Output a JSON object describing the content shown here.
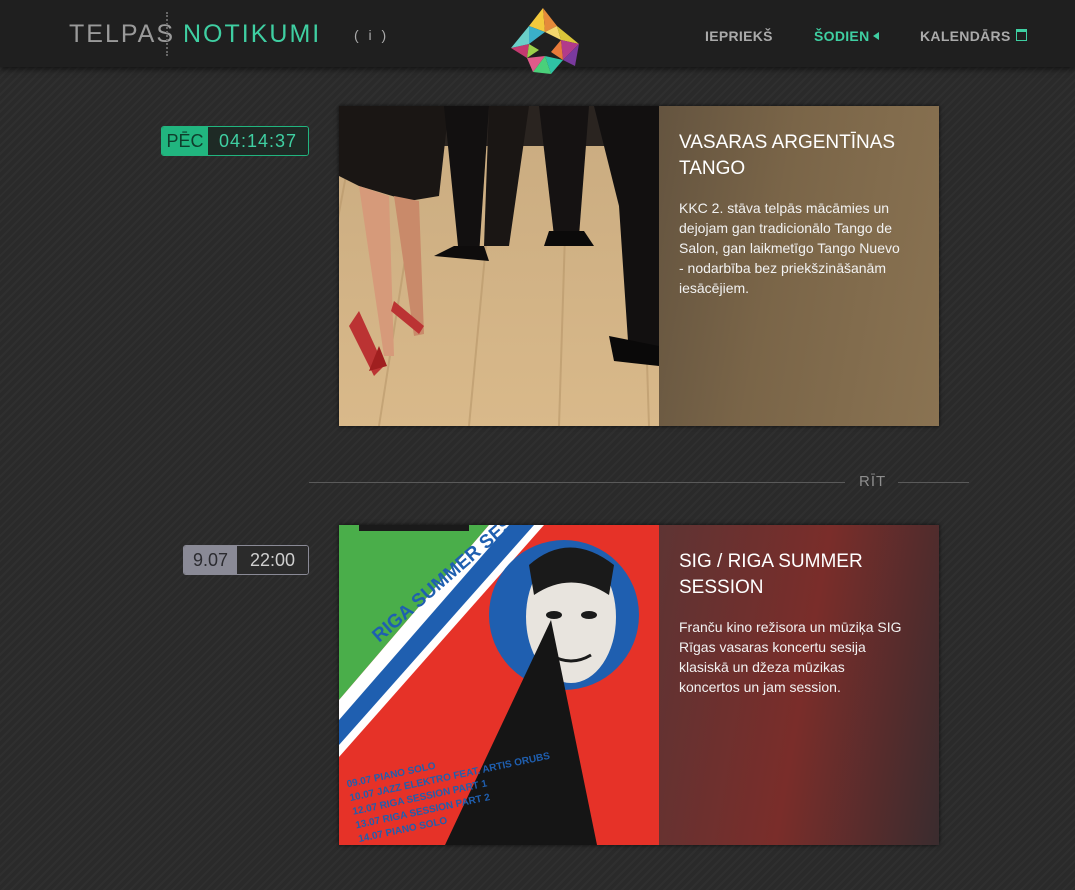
{
  "header": {
    "brand_left": "TELPAS",
    "brand_right": "NOTIKUMI",
    "info_label": "( i )",
    "nav": {
      "prev": "IEPRIEKŠ",
      "today": "ŠODIEN",
      "calendar": "KALENDĀRS"
    }
  },
  "colors": {
    "accent": "#3fcfa2",
    "badge_now": "#21b57f",
    "badge_future": "#8a8a96",
    "background": "#2a2a2a"
  },
  "events": [
    {
      "badge_left": "PĒC",
      "badge_right": "04:14:37",
      "title": "VASARAS ARGENTĪNAS TANGO",
      "description": "KKC 2. stāva telpās mācāmies un dejojam gan tradicionālo Tango de Salon, gan laikmetīgo Tango Nuevo - nodarbība bez priekšzināšanām iesācējiem."
    },
    {
      "badge_left": "9.07",
      "badge_right": "22:00",
      "title": "SIG / RIGA SUMMER SESSION",
      "description": "Franču kino režisora un mūziķa SIG Rīgas vasaras koncertu sesija klasiskā un džeza mūzikas koncertos un jam session."
    }
  ],
  "day_separator": "RĪT",
  "poster": {
    "banner_text": "RIGA SUMMER SESSION",
    "lines": [
      "09.07 PIANO SOLO",
      "10.07 JAZZ ELEKTRO FEAT. ARTIS ORUBS",
      "12.07 RIGA SESSION PART 1",
      "13.07 RIGA SESSION PART 2",
      "14.07 PIANO SOLO"
    ]
  }
}
